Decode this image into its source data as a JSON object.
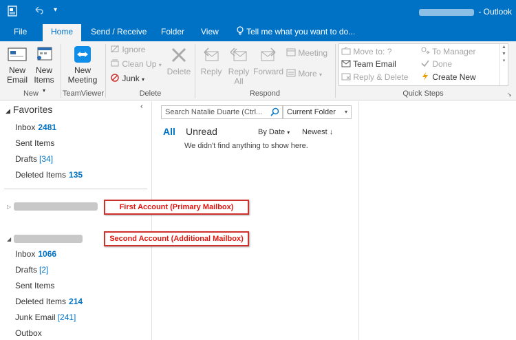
{
  "titlebar": {
    "app_name": "- Outlook"
  },
  "tabs": [
    {
      "label": "File"
    },
    {
      "label": "Home"
    },
    {
      "label": "Send / Receive"
    },
    {
      "label": "Folder"
    },
    {
      "label": "View"
    },
    {
      "label": "Tell me what you want to do..."
    }
  ],
  "ribbon": {
    "new_email": {
      "line1": "New",
      "line2": "Email"
    },
    "new_items": {
      "line1": "New",
      "line2": "Items"
    },
    "new_meeting": {
      "line1": "New",
      "line2": "Meeting"
    },
    "ignore": "Ignore",
    "clean_up": "Clean Up",
    "junk": "Junk",
    "delete": "Delete",
    "reply": "Reply",
    "reply_all": {
      "line1": "Reply",
      "line2": "All"
    },
    "forward": "Forward",
    "meeting": "Meeting",
    "more": "More",
    "quick_steps": {
      "move_to": "Move to: ?",
      "to_manager": "To Manager",
      "team_email": "Team Email",
      "done": "Done",
      "reply_delete": "Reply & Delete",
      "create_new": "Create New"
    },
    "groups": {
      "new": "New",
      "teamviewer": "TeamViewer",
      "delete": "Delete",
      "respond": "Respond",
      "quick_steps": "Quick Steps"
    }
  },
  "folderpane": {
    "favorites_label": "Favorites",
    "favorites": [
      {
        "label": "Inbox",
        "count": "2481"
      },
      {
        "label": "Sent Items"
      },
      {
        "label": "Drafts",
        "bracket": "[34]"
      },
      {
        "label": "Deleted Items",
        "count": "135"
      }
    ],
    "account2_folders": [
      {
        "label": "Inbox",
        "count": "1066"
      },
      {
        "label": "Drafts",
        "bracket": "[2]"
      },
      {
        "label": "Sent Items"
      },
      {
        "label": "Deleted Items",
        "count": "214"
      },
      {
        "label": "Junk Email",
        "bracket": "[241]"
      },
      {
        "label": "Outbox"
      }
    ]
  },
  "msglist": {
    "search_placeholder": "Search Natalie Duarte (Ctrl...",
    "scope": "Current Folder",
    "filter_all": "All",
    "filter_unread": "Unread",
    "sort_by": "By Date",
    "sort_order": "Newest",
    "empty_message": "We didn't find anything to show here."
  },
  "annotations": {
    "first": "First Account (Primary Mailbox)",
    "second": "Second Account (Additional Mailbox)"
  },
  "colors": {
    "accent": "#0072c6",
    "annotation": "#e0160f"
  }
}
